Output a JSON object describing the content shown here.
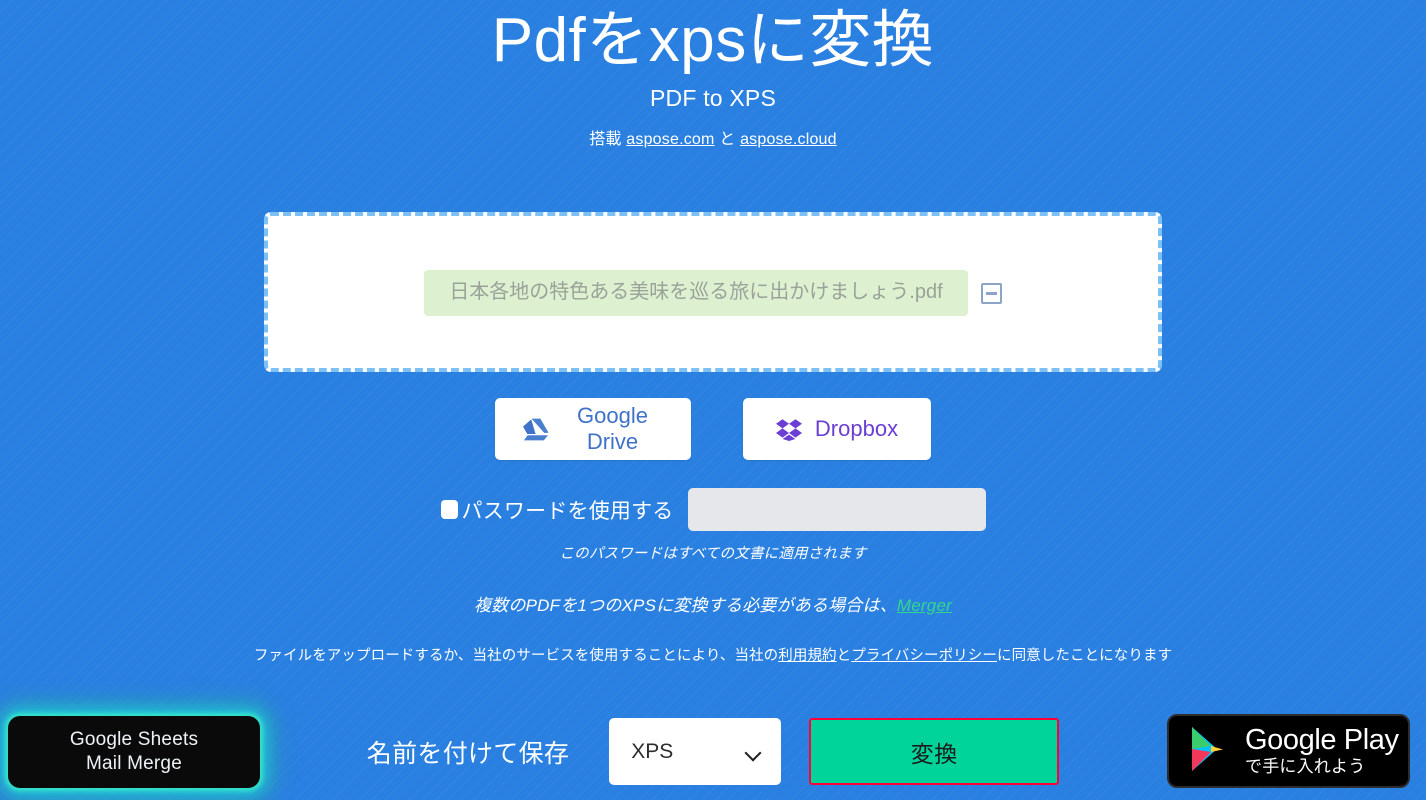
{
  "theme": {
    "background": "#2a80e0",
    "accent_green": "#00d49a",
    "link_green": "#2fd98c",
    "highlight_red": "#fd0139",
    "chip_green": "#ddf0cf",
    "dashed_border": "#7cc0f5"
  },
  "header": {
    "title": "Pdfをxpsに変換",
    "subtitle": "PDF to XPS",
    "powered_prefix": "搭載",
    "powered_link1": "aspose.com",
    "powered_conjunction": "と",
    "powered_link2": "aspose.cloud"
  },
  "dropzone": {
    "file_name": "日本各地の特色ある美味を巡る旅に出かけましょう.pdf",
    "remove_icon": "minus-square-icon"
  },
  "cloud_buttons": [
    {
      "label": "Google Drive",
      "icon": "google-drive-icon"
    },
    {
      "label": "Dropbox",
      "icon": "dropbox-icon"
    }
  ],
  "password": {
    "checkbox_label": "パスワードを使用する",
    "checked": false,
    "input_value": "",
    "input_placeholder": "",
    "hint": "このパスワードはすべての文書に適用されます"
  },
  "merger_note": {
    "text": "複数のPDFを1つのXPSに変換する必要がある場合は、",
    "link": "Merger"
  },
  "terms": {
    "part1": "ファイルをアップロードするか、当社のサービスを使用することにより、当社の",
    "link1": "利用規約",
    "part2": "と",
    "link2": "プライバシーポリシー",
    "part3": "に同意したことになります"
  },
  "action_bar": {
    "save_as_label": "名前を付けて保存",
    "format_value": "XPS",
    "format_options": [
      "XPS"
    ],
    "convert_label": "変換",
    "chevron_icon": "chevron-down-icon"
  },
  "ads": {
    "left": {
      "line1": "Google Sheets",
      "line2": "Mail Merge"
    },
    "right": {
      "title": "Google Play",
      "subtitle": "で手に入れよう",
      "icon": "google-play-icon"
    }
  }
}
